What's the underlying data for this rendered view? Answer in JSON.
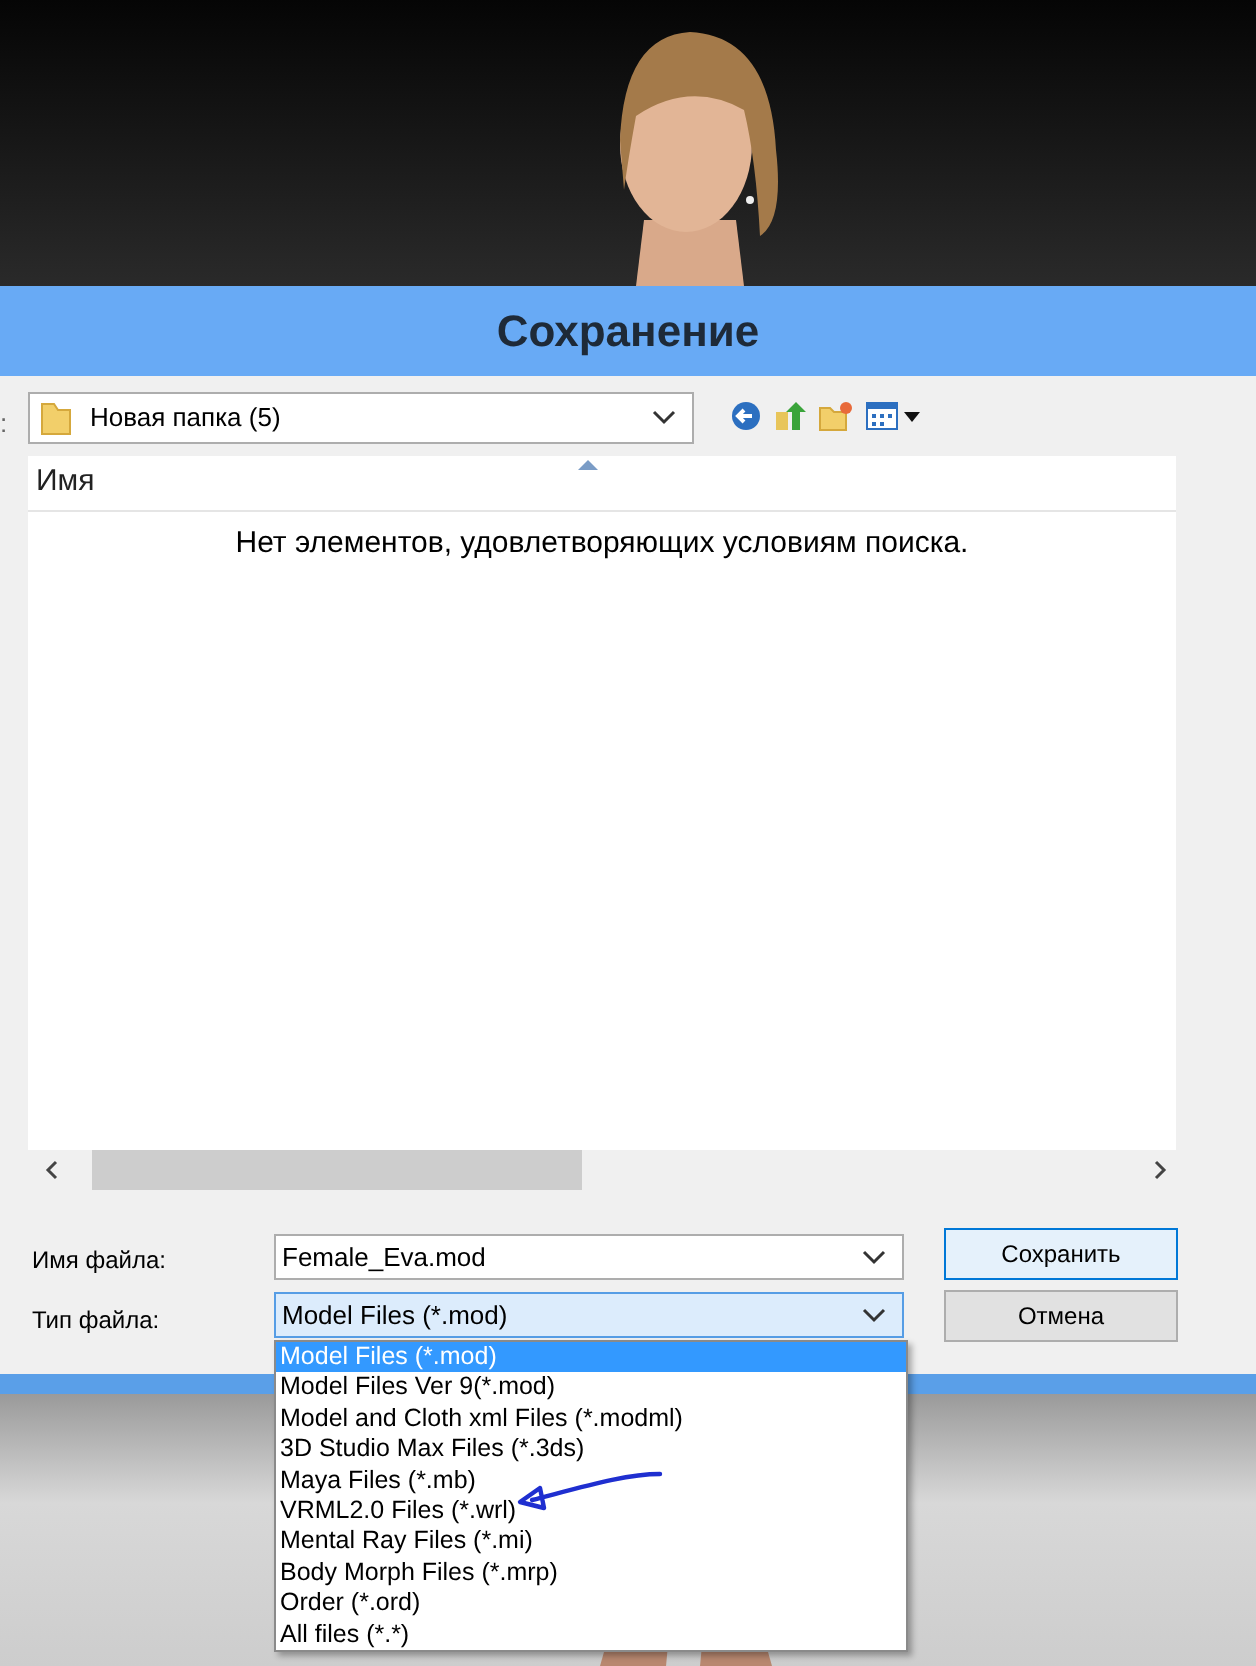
{
  "dialog": {
    "title": "Сохранение",
    "look_in": {
      "label": ":",
      "value": "Новая папка (5)"
    },
    "file_list": {
      "columns": [
        {
          "label": "Имя",
          "sorted": true
        }
      ],
      "empty_message": "Нет элементов, удовлетворяющих условиям поиска."
    },
    "file_name": {
      "label": "Имя файла:",
      "value": "Female_Eva.mod"
    },
    "file_type": {
      "label": "Тип файла:",
      "value": "Model Files (*.mod)",
      "expanded": true,
      "options": [
        {
          "label": "Model Files (*.mod)",
          "selected": true
        },
        {
          "label": "Model Files Ver 9(*.mod)",
          "selected": false
        },
        {
          "label": "Model and Cloth xml Files (*.modml)",
          "selected": false
        },
        {
          "label": "3D Studio Max Files (*.3ds)",
          "selected": false
        },
        {
          "label": "Maya Files (*.mb)",
          "selected": false
        },
        {
          "label": "VRML2.0 Files (*.wrl)",
          "selected": false,
          "annotated": true
        },
        {
          "label": "Mental Ray Files (*.mi)",
          "selected": false
        },
        {
          "label": "Body Morph Files (*.mrp)",
          "selected": false
        },
        {
          "label": "Order (*.ord)",
          "selected": false
        },
        {
          "label": "All files (*.*)",
          "selected": false
        }
      ]
    },
    "buttons": [
      {
        "label": "Сохранить",
        "default": true
      },
      {
        "label": "Отмена",
        "default": false
      }
    ]
  }
}
